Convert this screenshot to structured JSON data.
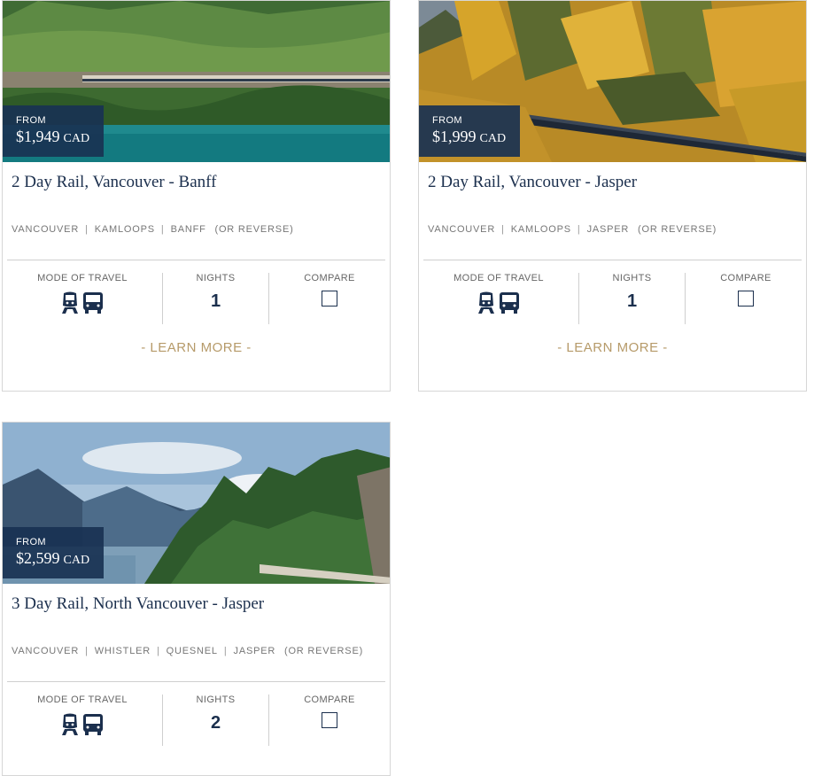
{
  "labels": {
    "from": "FROM",
    "mode_of_travel": "MODE OF TRAVEL",
    "nights": "NIGHTS",
    "compare": "COMPARE",
    "learn_more": "- LEARN MORE -",
    "route_separator": "|"
  },
  "colors": {
    "navy": "#1b2f4d",
    "badge": "#193252",
    "accent": "#b69a69"
  },
  "cards": [
    {
      "title": "2 Day Rail, Vancouver - Banff",
      "price": "$1,949",
      "currency": "CAD",
      "route": [
        "VANCOUVER",
        "KAMLOOPS",
        "BANFF"
      ],
      "route_suffix": "(OR REVERSE)",
      "nights": "1",
      "travel_icons": [
        "train-icon",
        "bus-icon"
      ]
    },
    {
      "title": "2 Day Rail, Vancouver - Jasper",
      "price": "$1,999",
      "currency": "CAD",
      "route": [
        "VANCOUVER",
        "KAMLOOPS",
        "JASPER"
      ],
      "route_suffix": "(OR REVERSE)",
      "nights": "1",
      "travel_icons": [
        "train-icon",
        "bus-icon"
      ]
    },
    {
      "title": "3 Day Rail, North Vancouver - Jasper",
      "price": "$2,599",
      "currency": "CAD",
      "route": [
        "VANCOUVER",
        "WHISTLER",
        "QUESNEL",
        "JASPER"
      ],
      "route_suffix": "(OR REVERSE)",
      "nights": "2",
      "travel_icons": [
        "train-icon",
        "bus-icon"
      ]
    }
  ]
}
